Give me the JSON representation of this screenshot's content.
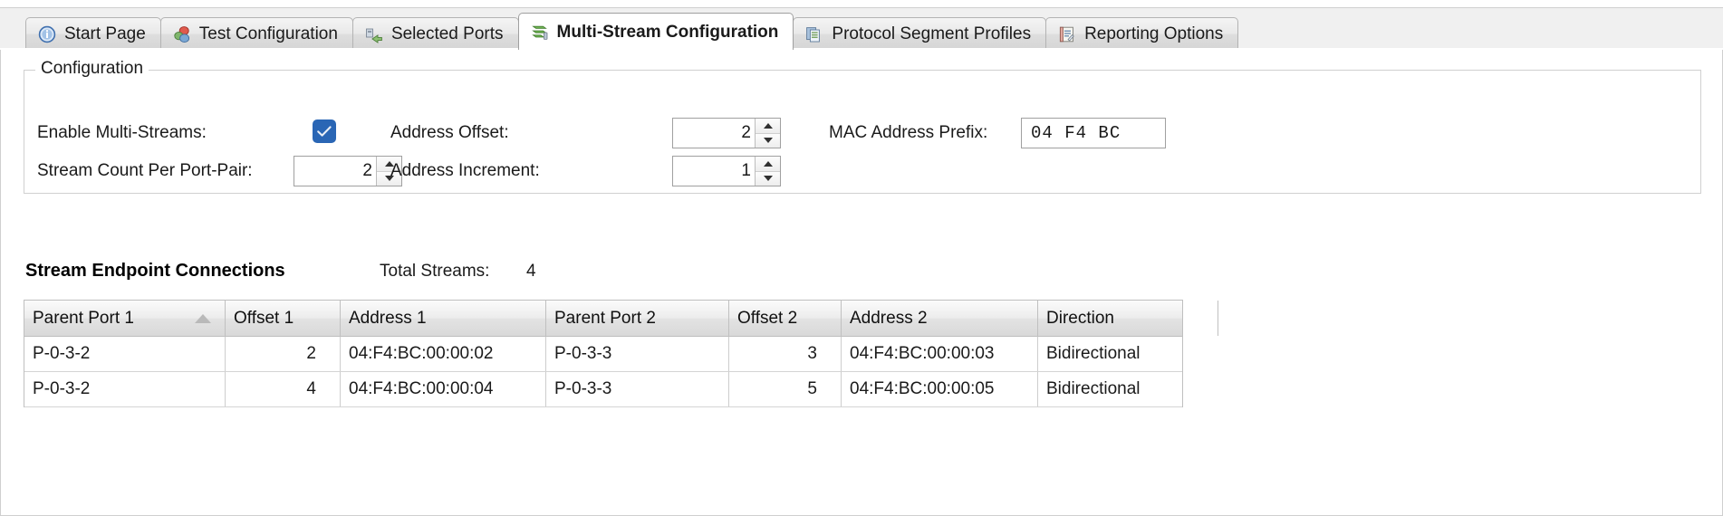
{
  "tabs": [
    {
      "label": "Start Page",
      "icon": "info-icon",
      "active": false
    },
    {
      "label": "Test Configuration",
      "icon": "test-config-icon",
      "active": false
    },
    {
      "label": "Selected Ports",
      "icon": "selected-ports-icon",
      "active": false
    },
    {
      "label": "Multi-Stream Configuration",
      "icon": "multi-stream-icon",
      "active": true
    },
    {
      "label": "Protocol Segment Profiles",
      "icon": "protocol-profiles-icon",
      "active": false
    },
    {
      "label": "Reporting Options",
      "icon": "reporting-options-icon",
      "active": false
    }
  ],
  "config": {
    "group_title": "Configuration",
    "enable_multistreams_label": "Enable Multi-Streams:",
    "enable_multistreams_checked": true,
    "stream_count_label": "Stream Count Per Port-Pair:",
    "stream_count_value": "2",
    "address_offset_label": "Address Offset:",
    "address_offset_value": "2",
    "address_increment_label": "Address Increment:",
    "address_increment_value": "1",
    "mac_prefix_label": "MAC Address Prefix:",
    "mac_prefix_value": "04 F4 BC"
  },
  "endpoints": {
    "title": "Stream Endpoint Connections",
    "total_streams_label": "Total Streams:",
    "total_streams_value": "4",
    "columns": [
      "Parent Port 1",
      "Offset 1",
      "Address 1",
      "Parent Port 2",
      "Offset 2",
      "Address 2",
      "Direction"
    ],
    "sorted_column": "Parent Port 1",
    "sort_direction": "ascending",
    "rows": [
      {
        "parent_port_1": "P-0-3-2",
        "offset_1": "2",
        "address_1": "04:F4:BC:00:00:02",
        "parent_port_2": "P-0-3-3",
        "offset_2": "3",
        "address_2": "04:F4:BC:00:00:03",
        "direction": "Bidirectional"
      },
      {
        "parent_port_1": "P-0-3-2",
        "offset_1": "4",
        "address_1": "04:F4:BC:00:00:04",
        "parent_port_2": "P-0-3-3",
        "offset_2": "5",
        "address_2": "04:F4:BC:00:00:05",
        "direction": "Bidirectional"
      }
    ]
  },
  "colors": {
    "checkbox_blue": "#2a66b5",
    "tab_active_bg": "#ffffff",
    "grid_header_bg": "#e6e6e6"
  }
}
